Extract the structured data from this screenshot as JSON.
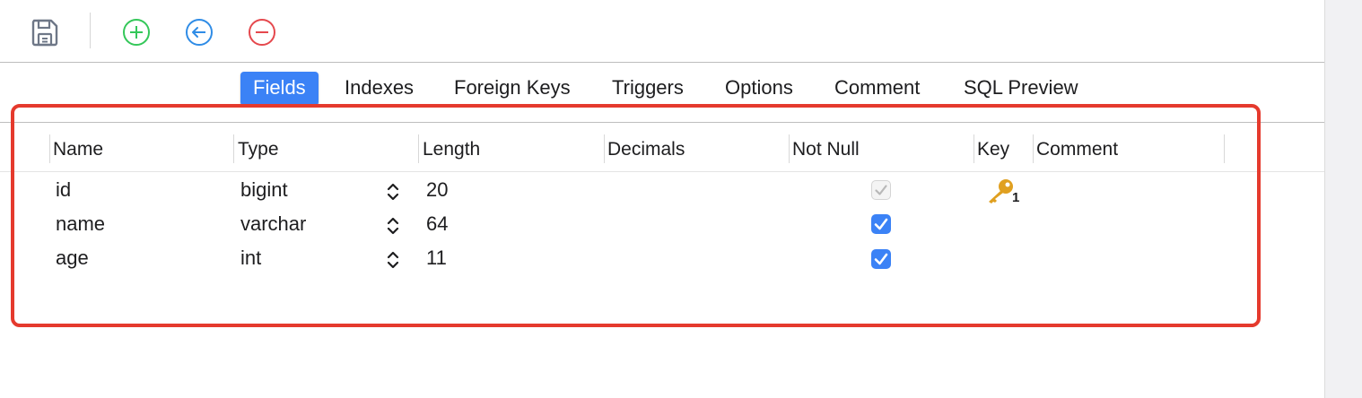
{
  "toolbar": {
    "buttons": [
      {
        "name": "save-icon"
      },
      {
        "name": "add-field-icon",
        "color": "#34c759"
      },
      {
        "name": "insert-field-icon",
        "color": "#2f8ce6"
      },
      {
        "name": "delete-field-icon",
        "color": "#e5484d"
      }
    ]
  },
  "tabs": [
    "Fields",
    "Indexes",
    "Foreign Keys",
    "Triggers",
    "Options",
    "Comment",
    "SQL Preview"
  ],
  "active_tab": "Fields",
  "columns": [
    "Name",
    "Type",
    "Length",
    "Decimals",
    "Not Null",
    "Key",
    "Comment"
  ],
  "rows": [
    {
      "name": "id",
      "type": "bigint",
      "length": "20",
      "decimals": "",
      "not_null": true,
      "not_null_disabled": true,
      "key": "1",
      "comment": ""
    },
    {
      "name": "name",
      "type": "varchar",
      "length": "64",
      "decimals": "",
      "not_null": true,
      "not_null_disabled": false,
      "key": "",
      "comment": ""
    },
    {
      "name": "age",
      "type": "int",
      "length": "11",
      "decimals": "",
      "not_null": true,
      "not_null_disabled": false,
      "key": "",
      "comment": ""
    }
  ],
  "colors": {
    "accent": "#3b82f6",
    "highlight": "#e53a2d",
    "key_icon": "#e0a020"
  }
}
